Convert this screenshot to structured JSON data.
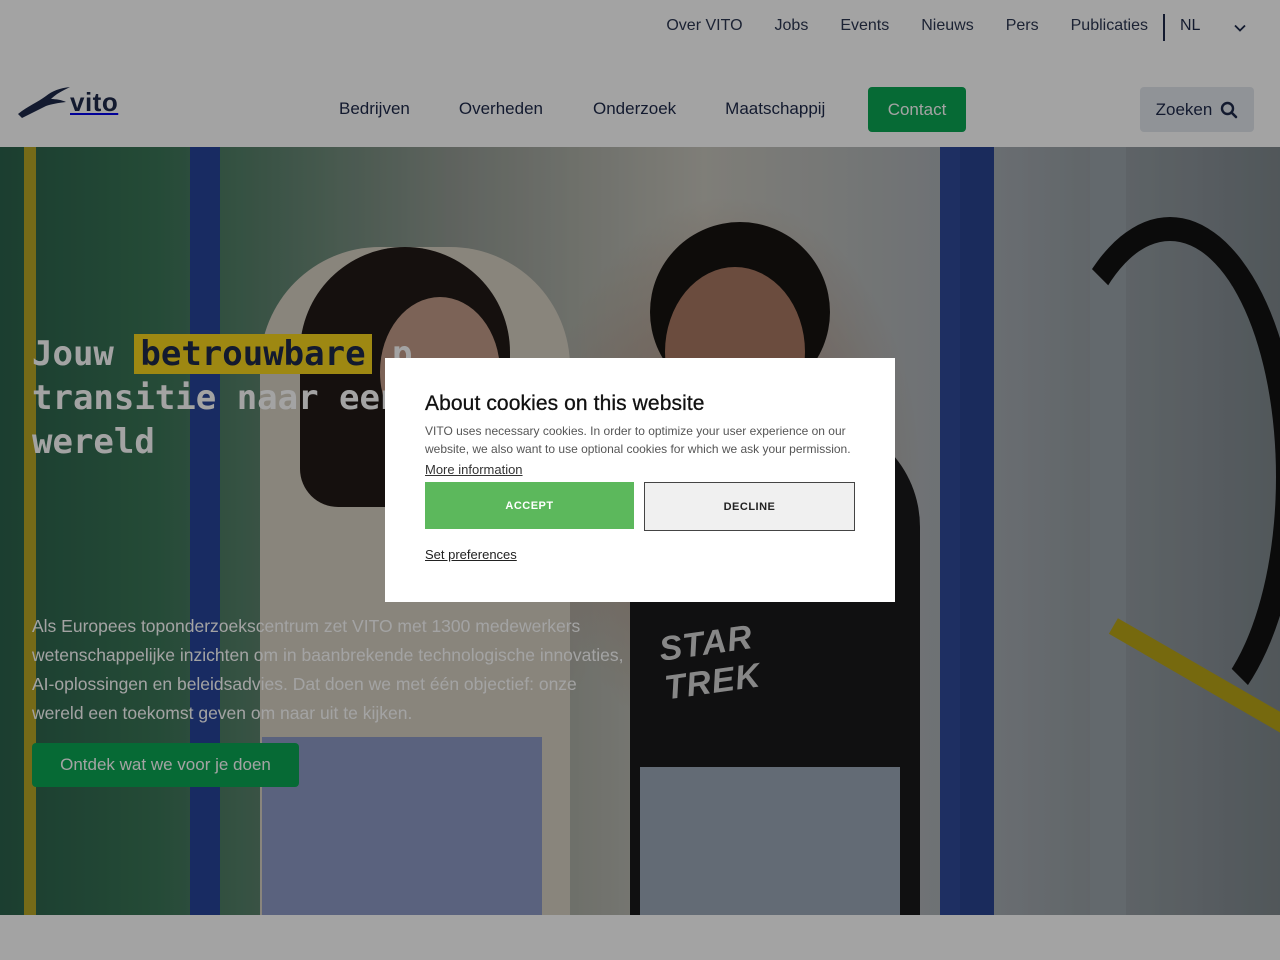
{
  "topbar": {
    "links": [
      "Over VITO",
      "Jobs",
      "Events",
      "Nieuws",
      "Pers",
      "Publicaties"
    ],
    "language": "NL"
  },
  "brand": {
    "wordmark": "vito"
  },
  "nav": {
    "items": [
      "Bedrijven",
      "Overheden",
      "Onderzoek",
      "Maatschappij"
    ],
    "contact_label": "Contact",
    "search_label": "Zoeken"
  },
  "hero": {
    "title_pre": "Jouw",
    "title_highlight": "betrouwbare",
    "title_post": "p… transitie naar een du… wereld",
    "title_line1_tail": "p",
    "title_line2": "transitie naar een du",
    "title_line3": "wereld",
    "description": "Als Europees toponderzoekscentrum zet VITO met 1300 medewerkers wetenschappelijke inzichten om in baanbrekende technologische innovaties, AI-oplossingen en beleidsadvies. Dat doen we met één objectief: onze wereld een toekomst geven om naar uit te kijken.",
    "cta_label": "Ontdek wat we voor je doen",
    "shirt_text": "STAR TREK"
  },
  "cookie_modal": {
    "title": "About cookies on this website",
    "body": "VITO uses necessary cookies. In order to optimize your user experience on our website, we also want to use optional cookies for which we ask your permission.",
    "more_info": "More information",
    "accept_label": "ACCEPT",
    "decline_label": "DECLINE",
    "preferences_label": "Set preferences"
  },
  "colors": {
    "brand_navy": "#1e2a4a",
    "brand_green": "#0aa653",
    "highlight_yellow": "#f7d51d",
    "accept_green": "#5cb85c"
  },
  "icons": [
    "vito-bird-logo-icon",
    "chevron-down-icon",
    "search-icon"
  ]
}
